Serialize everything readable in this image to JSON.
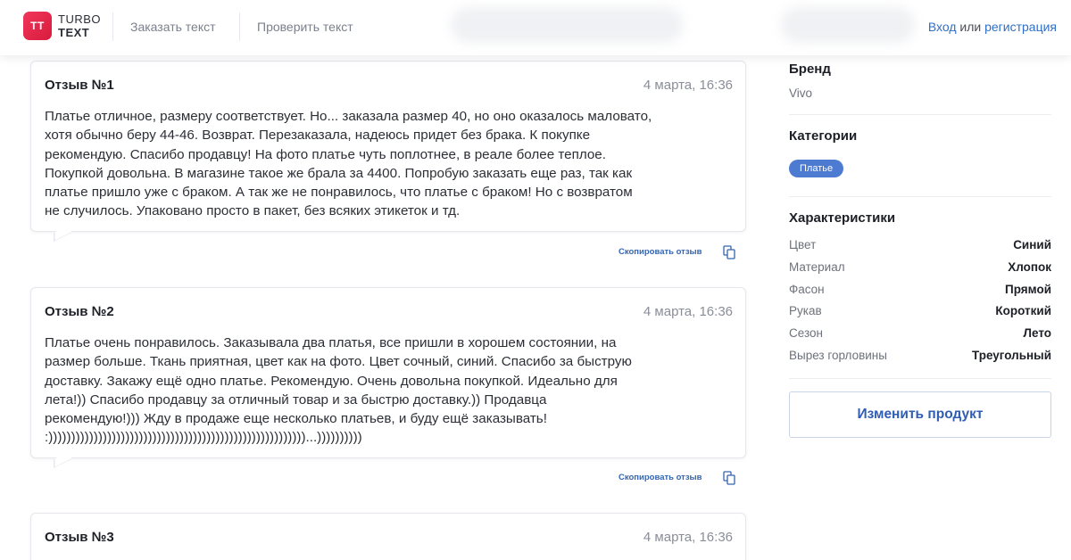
{
  "header": {
    "logo_mark": "TT",
    "logo_line1": "TURBO",
    "logo_line2": "TEXT",
    "nav": [
      "Заказать текст",
      "Проверить текст"
    ],
    "auth_login": "Вход",
    "auth_or": "или",
    "auth_register": "регистрация"
  },
  "reviews": [
    {
      "title": "Отзыв №1",
      "date": "4 марта, 16:36",
      "lines": [
        "Платье отличное, размеру соответствует. Но... заказала размер 40, но оно оказалось маловато,",
        "хотя обычно беру 44-46. Возврат. Перезаказала, надеюсь придет без брака. К покупке",
        "рекомендую. Спасибо продавцу! На фото платье чуть поплотнее, в реале более теплое.",
        "Покупкой довольна. В магазине такое же брала за 4400. Попробую заказать еще раз, так как",
        "платье пришло уже с браком. А так же не понравилось, что платье с браком! Но с возвратом",
        "не случилось. Упаковано просто в пакет, без всяких этикеток и тд."
      ],
      "copy_label": "Скопировать отзыв"
    },
    {
      "title": "Отзыв №2",
      "date": "4 марта, 16:36",
      "lines": [
        "Платье очень понравилось. Заказывала два платья, все пришли в хорошем состоянии, на",
        "размер больше. Ткань приятная, цвет как на фото. Цвет сочный, синий. Спасибо за быструю",
        "доставку. Закажу ещё одно платье. Рекомендую. Очень довольна покупкой. Идеально для",
        "лета!)) Спасибо продавцу за отличный товар и за быстрю доставку.)) Продавца",
        "рекомендую!))) Жду в продаже еще несколько платьев, и буду ещё заказывать!",
        ":)))))))))))))))))))))))))))))))))))))))))))))))))))))))))...))))))))))"
      ],
      "copy_label": "Скопировать отзыв"
    },
    {
      "title": "Отзыв №3",
      "date": "4 марта, 16:36"
    }
  ],
  "sidebar": {
    "brand_heading": "Бренд",
    "brand_value": "Vivo",
    "categories_heading": "Категории",
    "category_tag": "Платье",
    "specs_heading": "Характеристики",
    "specs": [
      {
        "key": "Цвет",
        "value": "Синий"
      },
      {
        "key": "Материал",
        "value": "Хлопок"
      },
      {
        "key": "Фасон",
        "value": "Прямой"
      },
      {
        "key": "Рукав",
        "value": "Короткий"
      },
      {
        "key": "Сезон",
        "value": "Лето"
      },
      {
        "key": "Вырез горловины",
        "value": "Треугольный"
      }
    ],
    "edit_button": "Изменить продукт"
  },
  "colors": {
    "brand_red": "#e8284c",
    "link_blue": "#2f6fc6",
    "tag_blue": "#4d7bd1"
  }
}
